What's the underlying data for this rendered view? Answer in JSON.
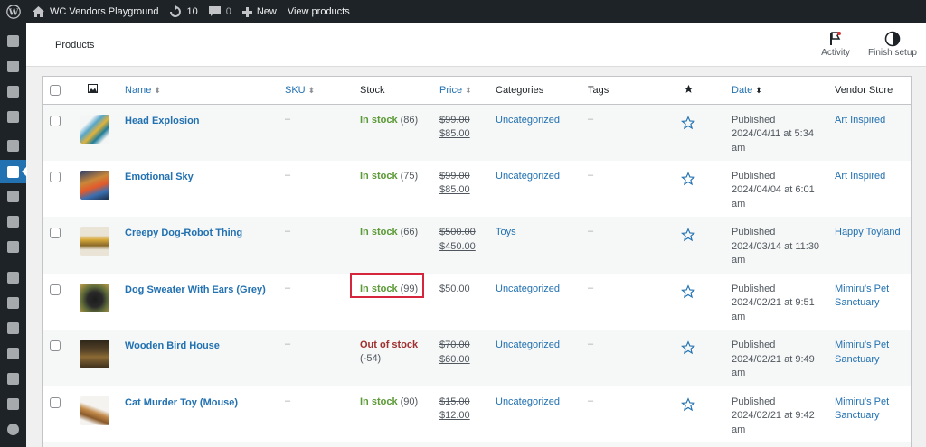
{
  "adminbar": {
    "site_name": "WC Vendors Playground",
    "updates_count": "10",
    "comments_count": "0",
    "new_label": "New",
    "view_products_label": "View products"
  },
  "header": {
    "title": "Products",
    "activity_label": "Activity",
    "finish_setup_label": "Finish setup"
  },
  "table": {
    "columns": {
      "name": "Name",
      "sku": "SKU",
      "stock": "Stock",
      "price": "Price",
      "categories": "Categories",
      "tags": "Tags",
      "date": "Date",
      "vendor": "Vendor Store"
    },
    "rows": [
      {
        "name": "Head Explosion",
        "sku": "–",
        "stock_status": "In stock",
        "stock_qty": "(86)",
        "price_old": "$99.00",
        "price_new": "$85.00",
        "category": "Uncategorized",
        "tags": "–",
        "date_status": "Published",
        "date_line2": "2024/04/11 at 5:34",
        "date_line3": "am",
        "vendor_line1": "Art Inspired",
        "vendor_line2": ""
      },
      {
        "name": "Emotional Sky",
        "sku": "–",
        "stock_status": "In stock",
        "stock_qty": "(75)",
        "price_old": "$99.00",
        "price_new": "$85.00",
        "category": "Uncategorized",
        "tags": "–",
        "date_status": "Published",
        "date_line2": "2024/04/04 at 6:01",
        "date_line3": "am",
        "vendor_line1": "Art Inspired",
        "vendor_line2": ""
      },
      {
        "name": "Creepy Dog-Robot Thing",
        "sku": "–",
        "stock_status": "In stock",
        "stock_qty": "(66)",
        "price_old": "$500.00",
        "price_new": "$450.00",
        "category": "Toys",
        "tags": "–",
        "date_status": "Published",
        "date_line2": "2024/03/14 at 11:30",
        "date_line3": "am",
        "vendor_line1": "Happy Toyland",
        "vendor_line2": ""
      },
      {
        "name": "Dog Sweater With Ears (Grey)",
        "sku": "–",
        "stock_status": "In stock",
        "stock_qty": "(99)",
        "price_old": "",
        "price_new": "$50.00",
        "category": "Uncategorized",
        "tags": "–",
        "date_status": "Published",
        "date_line2": "2024/02/21 at 9:51",
        "date_line3": "am",
        "vendor_line1": "Mimiru's Pet",
        "vendor_line2": "Sanctuary"
      },
      {
        "name": "Wooden Bird House",
        "sku": "–",
        "stock_status": "Out of stock",
        "stock_qty": "(-54)",
        "price_old": "$70.00",
        "price_new": "$60.00",
        "category": "Uncategorized",
        "tags": "–",
        "date_status": "Published",
        "date_line2": "2024/02/21 at 9:49",
        "date_line3": "am",
        "vendor_line1": "Mimiru's Pet",
        "vendor_line2": "Sanctuary"
      },
      {
        "name": "Cat Murder Toy (Mouse)",
        "sku": "–",
        "stock_status": "In stock",
        "stock_qty": "(90)",
        "price_old": "$15.00",
        "price_new": "$12.00",
        "category": "Uncategorized",
        "tags": "–",
        "date_status": "Published",
        "date_line2": "2024/02/21 at 9:42",
        "date_line3": "am",
        "vendor_line1": "Mimiru's Pet",
        "vendor_line2": "Sanctuary"
      }
    ]
  },
  "colors": {
    "accent": "#2271b1",
    "in_stock": "#5b9a36",
    "out_of_stock": "#a02f2f",
    "highlight": "#d6263d"
  }
}
